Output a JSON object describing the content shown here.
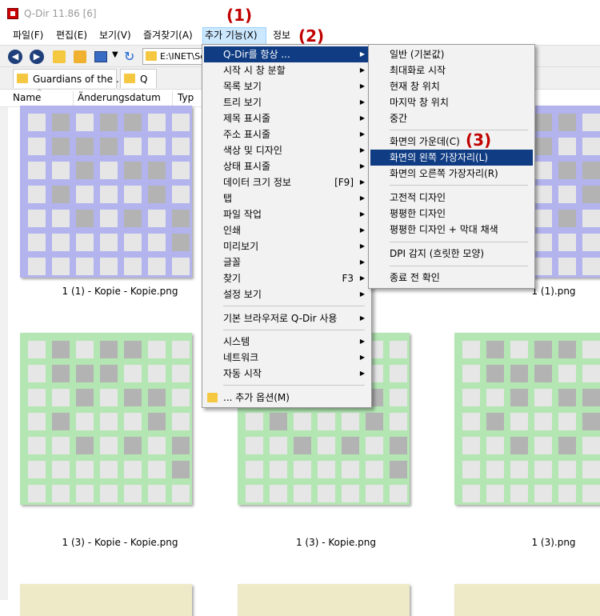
{
  "window": {
    "title": "Q-Dir 11.86 [6]"
  },
  "menubar": {
    "items": [
      {
        "label": "파일(F)"
      },
      {
        "label": "편집(E)"
      },
      {
        "label": "보기(V)"
      },
      {
        "label": "즐겨찾기(A)"
      },
      {
        "label": "추가 기능(X)"
      },
      {
        "label": "정보"
      }
    ]
  },
  "toolbar": {
    "back_icon": "back-arrow-icon",
    "forward_icon": "forward-arrow-icon",
    "address_path": "E:\\INET\\So"
  },
  "tabs": [
    {
      "label": "Guardians of the ..."
    },
    {
      "label": "Q"
    }
  ],
  "columns": [
    "Name",
    "Änderungsdatum",
    "Typ"
  ],
  "thumbnails": {
    "captions": [
      "1 (1) - Kopie - Kopie.png",
      "1 (1).png",
      "1 (3) - Kopie - Kopie.png",
      "1 (3) - Kopie.png",
      "1 (3).png"
    ]
  },
  "main_menu": {
    "items": [
      {
        "label": "Q-Dir를 항상 ...",
        "submenu": true
      },
      {
        "label": "시작 시 창 분할",
        "submenu": true
      },
      {
        "label": "목록 보기",
        "submenu": true
      },
      {
        "label": "트리 보기",
        "submenu": true
      },
      {
        "label": "제목 표시줄",
        "submenu": true
      },
      {
        "label": "주소 표시줄",
        "submenu": true
      },
      {
        "label": "색상 및 디자인",
        "submenu": true
      },
      {
        "label": "상태 표시줄",
        "submenu": true
      },
      {
        "label": "데이터 크기 정보",
        "shortcut": "[F9]",
        "submenu": true
      },
      {
        "label": "탭",
        "submenu": true
      },
      {
        "label": "파일 작업",
        "submenu": true
      },
      {
        "label": "인쇄",
        "submenu": true
      },
      {
        "label": "미리보기",
        "submenu": true
      },
      {
        "label": "글꼴",
        "submenu": true
      },
      {
        "label": "찾기",
        "shortcut": "F3",
        "submenu": true
      },
      {
        "label": "설정 보기",
        "submenu": true
      },
      {
        "label": "기본 브라우저로 Q-Dir 사용",
        "submenu": true
      },
      {
        "label": "시스템",
        "submenu": true
      },
      {
        "label": "네트워크",
        "submenu": true
      },
      {
        "label": "자동 시작",
        "submenu": true
      },
      {
        "label": "... 추가 옵션(M)"
      }
    ]
  },
  "sub_menu": {
    "items": [
      {
        "label": "일반 (기본값)"
      },
      {
        "label": "최대화로 시작"
      },
      {
        "label": "현재 창 위치"
      },
      {
        "label": "마지막 창 위치"
      },
      {
        "label": "중간"
      },
      {
        "label": "화면의 가운데(C)"
      },
      {
        "label": "화면의 왼쪽 가장자리(L)"
      },
      {
        "label": "화면의 오른쪽 가장자리(R)"
      },
      {
        "label": "고전적 디자인"
      },
      {
        "label": "평평한 디자인"
      },
      {
        "label": "평평한 디자인 + 막대 채색"
      },
      {
        "label": "DPI 감지 (흐릿한 모양)"
      },
      {
        "label": "종료 전 확인"
      }
    ]
  },
  "annotations": [
    "(1)",
    "(2)",
    "(3)"
  ],
  "colors": {
    "highlight": "#0f3c83",
    "menu_active": "#cce8ff",
    "annotation": "#c00000",
    "thumb_purple": "#b3b3ee",
    "thumb_green": "#b4e6b4"
  }
}
